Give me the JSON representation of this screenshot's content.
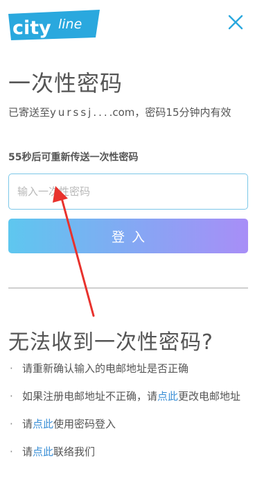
{
  "brand": {
    "logo_text_1": "city",
    "logo_text_2": "line",
    "accent": "#2aa8de"
  },
  "header": {
    "close_icon": "close-icon"
  },
  "page": {
    "title": "一次性密码",
    "sent_notice": "已寄送至y u r s s j . . . .com，密码15分钟内有效",
    "resend_timer": "55秒后可重新传送一次性密码"
  },
  "form": {
    "otp_placeholder": "输入一次性密码",
    "otp_value": "",
    "login_label": "登入"
  },
  "help": {
    "title": "无法收到一次性密码?",
    "items": [
      {
        "text": "请重新确认输入的电邮地址是否正确"
      },
      {
        "pre": "如果注册电邮地址不正确，请",
        "link": "点此",
        "post": "更改电邮地址"
      },
      {
        "pre": "请",
        "link": "点此",
        "post": "使用密码登入"
      },
      {
        "pre": "请",
        "link": "点此",
        "post": "联络我们"
      }
    ],
    "bullet": "·"
  },
  "colors": {
    "button_start": "#5ec7ef",
    "button_end": "#a88ef7",
    "link": "#3a8fd6",
    "arrow": "#e8322d"
  }
}
